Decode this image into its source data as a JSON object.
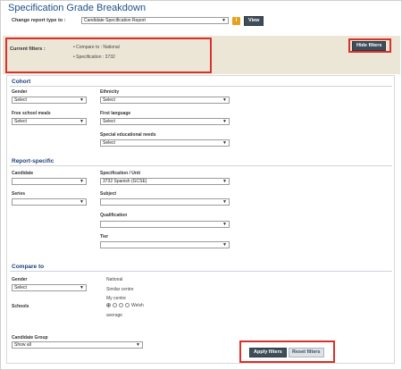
{
  "page": {
    "title": "Specification Grade Breakdown"
  },
  "report_type": {
    "label": "Change report type to :",
    "selected": "Candidate Specification Report",
    "info_icon": "info-icon",
    "view_label": "View"
  },
  "current_filters": {
    "label": "Current filters :",
    "items": [
      "Compare to : National",
      "Specification : 3732"
    ],
    "hide_label": "Hide filters"
  },
  "cohort": {
    "heading": "Cohort",
    "gender": {
      "label": "Gender",
      "value": "Select"
    },
    "ethnicity": {
      "label": "Ethnicity",
      "value": "Select"
    },
    "free_school_meals": {
      "label": "Free school meals",
      "value": "Select"
    },
    "first_language": {
      "label": "First language",
      "value": "Select"
    },
    "sen": {
      "label": "Special educational needs",
      "value": "Select"
    }
  },
  "report_specific": {
    "heading": "Report-specific",
    "candidate": {
      "label": "Candidate",
      "value": ""
    },
    "specification": {
      "label": "Specification / Unit",
      "value": "3732 Spanish (GCSE)"
    },
    "series": {
      "label": "Series",
      "value": ""
    },
    "subject": {
      "label": "Subject",
      "value": ""
    },
    "qualification": {
      "label": "Qualification",
      "value": ""
    },
    "tier": {
      "label": "Tier",
      "value": ""
    }
  },
  "compare_to": {
    "heading": "Compare to",
    "gender": {
      "label": "Gender",
      "value": "Select"
    },
    "options": [
      "National",
      "Similar centre",
      "My centre"
    ],
    "schools": {
      "label": "Schools",
      "welsh": "Welsh",
      "average": "average"
    },
    "candidate_group": {
      "label": "Candidate Group",
      "value": "Show all"
    }
  },
  "actions": {
    "apply_label": "Apply filters",
    "reset_label": "Reset filters"
  }
}
